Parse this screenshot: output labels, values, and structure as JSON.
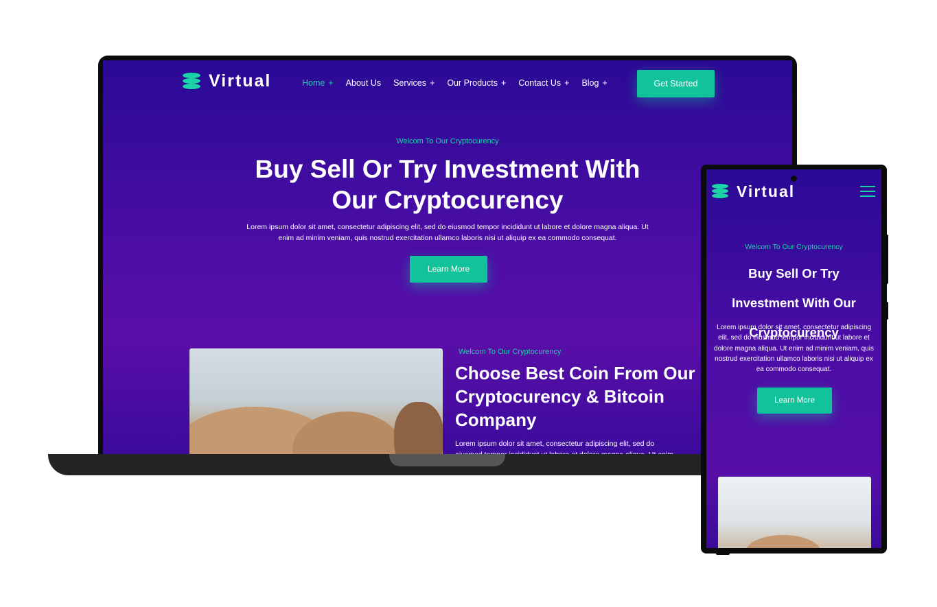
{
  "brand": {
    "name": "Virtual",
    "accent": "#12c29a",
    "bg_top": "#2a0a95",
    "bg_mid": "#5a0ea8"
  },
  "laptop": {
    "nav": {
      "items": [
        {
          "label": "Home",
          "plus": "+",
          "active": true
        },
        {
          "label": "About Us",
          "plus": ""
        },
        {
          "label": "Services",
          "plus": "+"
        },
        {
          "label": "Our Products",
          "plus": "+"
        },
        {
          "label": "Contact Us",
          "plus": "+"
        },
        {
          "label": "Blog",
          "plus": "+"
        }
      ],
      "cta": "Get Started"
    },
    "hero": {
      "eyebrow": "Welcom To Our Cryptocurency",
      "title": "Buy Sell Or Try Investment With Our Cryptocurency",
      "paragraph": "Lorem ipsum dolor sit amet, consectetur adipiscing elit, sed do eiusmod tempor incididunt ut labore et dolore magna aliqua. Ut enim ad minim veniam, quis nostrud exercitation ullamco laboris nisi ut aliquip ex ea commodo consequat.",
      "button": "Learn More"
    },
    "section2": {
      "eyebrow": "Welcom To Our Cryptocurency",
      "title": "Choose Best Coin From Our Cryptocurency & Bitcoin Company",
      "paragraph": "Lorem ipsum dolor sit amet, consectetur adipiscing elit, sed do eiusmod tempor incididunt ut labore et dolore magna aliqua. Ut enim"
    }
  },
  "phone": {
    "hero": {
      "eyebrow": "Welcom To Our Cryptocurency",
      "title": "Buy Sell Or Try Investment With Our Cryptocurency",
      "paragraph": "Lorem ipsum dolor sit amet, consectetur adipiscing elit, sed do eiusmod tempor incididunt ut labore et dolore magna aliqua. Ut enim ad minim veniam, quis nostrud exercitation ullamco laboris nisi ut aliquip ex ea commodo consequat.",
      "button": "Learn More"
    }
  }
}
